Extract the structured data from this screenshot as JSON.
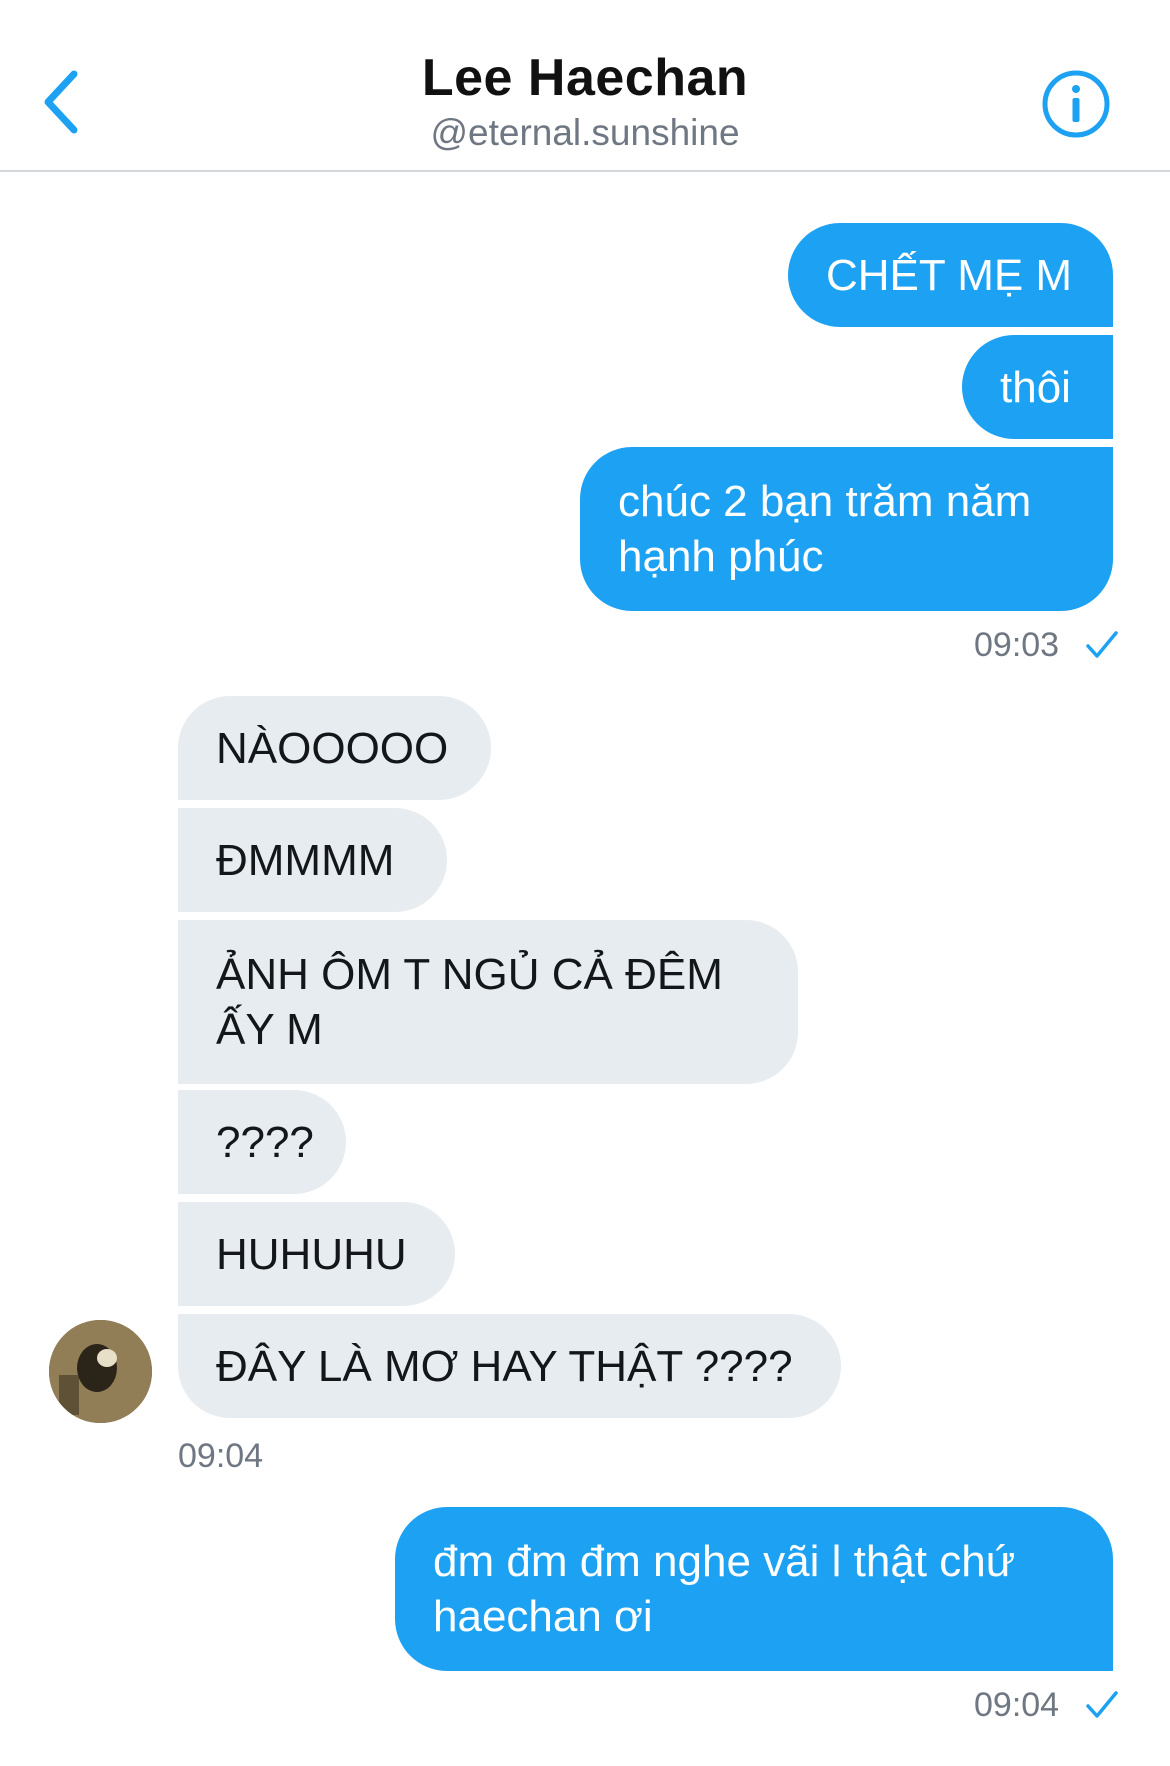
{
  "header": {
    "title": "Lee Haechan",
    "handle": "@eternal.sunshine"
  },
  "colors": {
    "accent": "#1da1f2",
    "incoming_bubble": "#e7ecf0",
    "muted_text": "#6e7782"
  },
  "messages": [
    {
      "text": "CHẾT MẸ M",
      "direction": "outgoing"
    },
    {
      "text": "thôi",
      "direction": "outgoing"
    },
    {
      "text": "chúc 2 bạn trăm năm hạnh phúc",
      "direction": "outgoing"
    },
    {
      "text": "NÀOOOOO",
      "direction": "incoming"
    },
    {
      "text": "ĐMMMM",
      "direction": "incoming"
    },
    {
      "text": "ẢNH ÔM T NGỦ CẢ ĐÊM ẤY M",
      "direction": "incoming"
    },
    {
      "text": "????",
      "direction": "incoming"
    },
    {
      "text": "HUHUHU",
      "direction": "incoming"
    },
    {
      "text": "ĐÂY LÀ MƠ HAY THẬT ????",
      "direction": "incoming"
    },
    {
      "text": "đm đm đm nghe vãi l thật chứ haechan ơi",
      "direction": "outgoing"
    }
  ],
  "timestamps": [
    "09:03",
    "09:04",
    "09:04"
  ],
  "icons": {
    "back": "chevron-left-icon",
    "info": "info-icon",
    "read": "checkmark-icon"
  }
}
